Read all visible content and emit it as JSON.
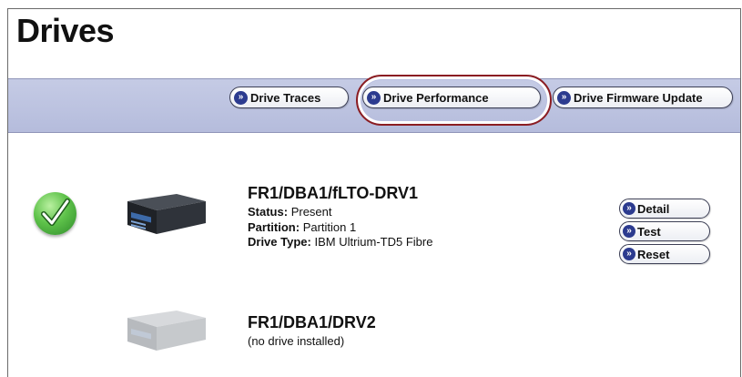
{
  "page": {
    "title": "Drives"
  },
  "toolbar": {
    "buttons": [
      {
        "label": "Drive Traces"
      },
      {
        "label": "Drive Performance",
        "highlighted": true
      },
      {
        "label": "Drive Firmware Update"
      }
    ],
    "highlight_color": "#8b1d22",
    "bar_color": "#bcc3e0"
  },
  "drives": [
    {
      "name": "FR1/DBA1/fLTO-DRV1",
      "status_icon": "green-check-icon",
      "image_icon": "tape-drive-icon",
      "status_label": "Status:",
      "status_value": "Present",
      "partition_label": "Partition:",
      "partition_value": "Partition 1",
      "type_label": "Drive Type:",
      "type_value": "IBM Ultrium-TD5 Fibre",
      "actions": [
        {
          "label": "Detail"
        },
        {
          "label": "Test"
        },
        {
          "label": "Reset"
        }
      ]
    },
    {
      "name": "FR1/DBA1/DRV2",
      "image_icon": "tape-drive-disabled-icon",
      "note": "(no drive installed)"
    }
  ],
  "colors": {
    "chevron": "#2c3b8f",
    "check": "#4bb53a"
  }
}
